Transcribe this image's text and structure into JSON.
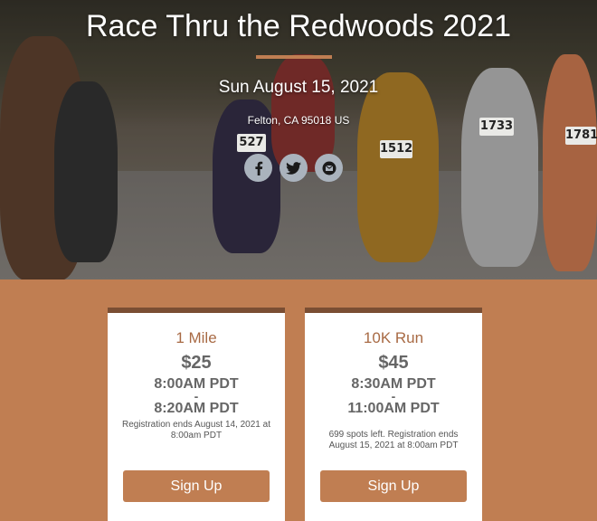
{
  "event": {
    "title": "Race Thru the Redwoods 2021",
    "date": "Sun August 15, 2021",
    "location": "Felton, CA 95018 US"
  },
  "social": [
    "facebook-icon",
    "twitter-icon",
    "email-icon"
  ],
  "bibs": [
    "527",
    "1512",
    "1733",
    "1781"
  ],
  "races": [
    {
      "name": "1 Mile",
      "price": "$25",
      "start": "8:00AM PDT",
      "dash": "-",
      "end": "8:20AM PDT",
      "note": "Registration ends August 14, 2021 at 8:00am PDT",
      "button": "Sign Up"
    },
    {
      "name": "10K Run",
      "price": "$45",
      "start": "8:30AM PDT",
      "dash": "-",
      "end": "11:00AM PDT",
      "note": "699 spots left. Registration ends August 15, 2021 at 8:00am PDT",
      "button": "Sign Up"
    }
  ],
  "colors": {
    "accent": "#c07e52",
    "card_top": "#7a4e33",
    "race_name": "#a86a44"
  }
}
